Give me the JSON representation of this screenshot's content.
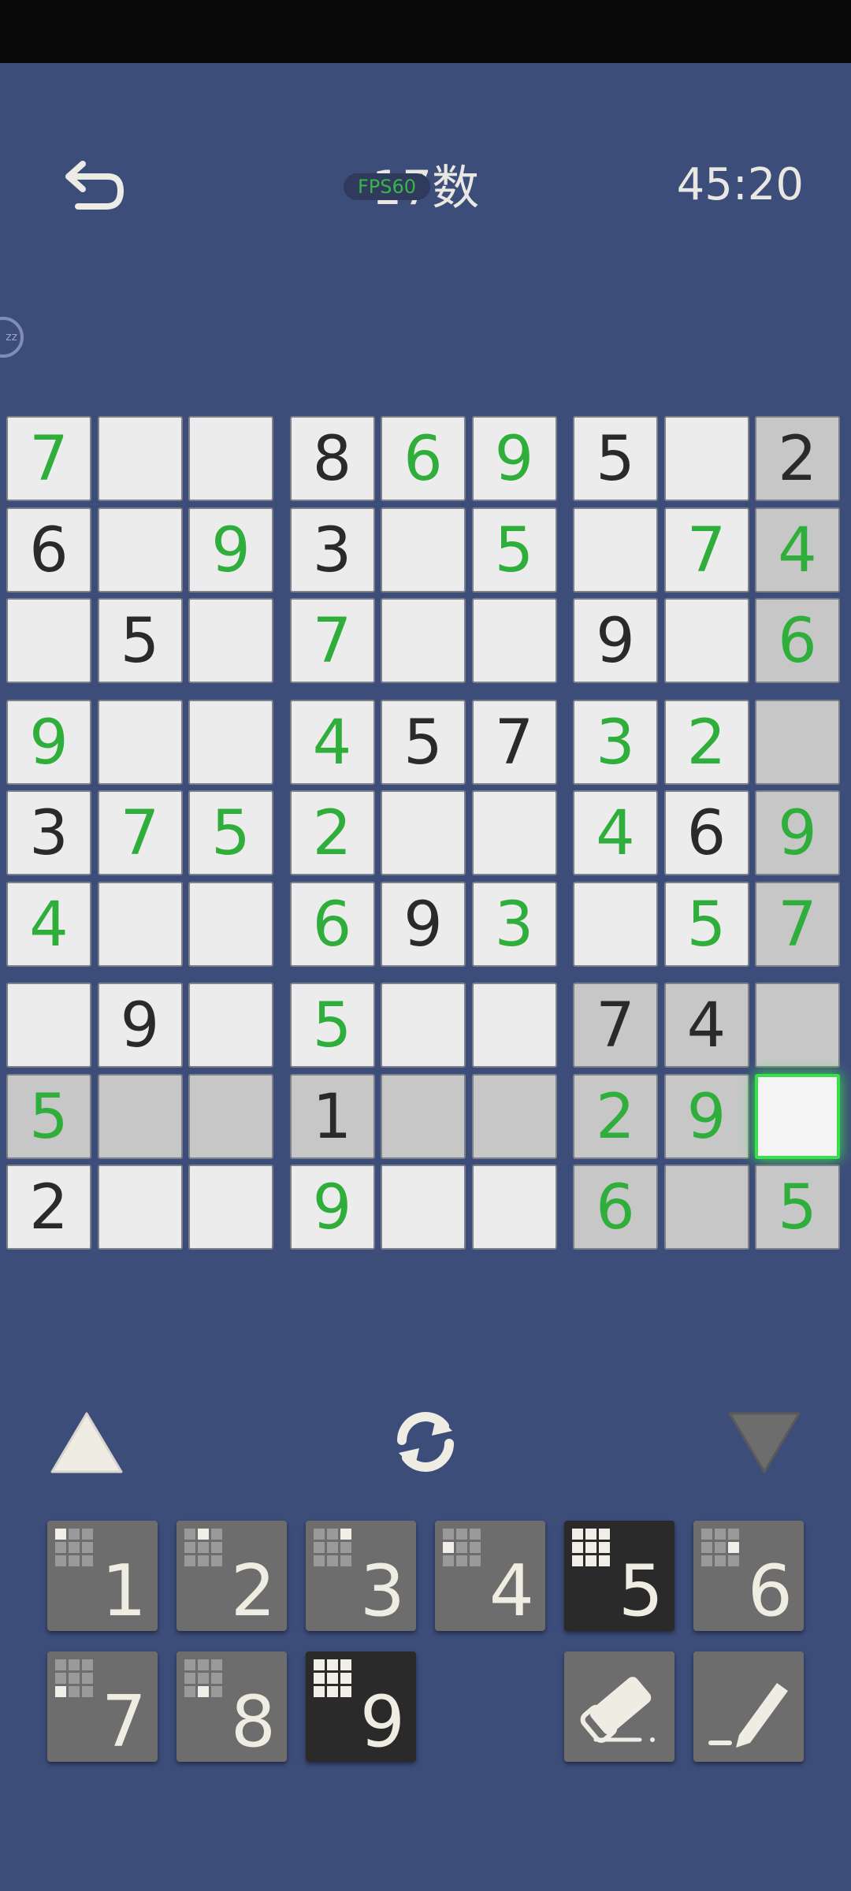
{
  "header": {
    "title": "17数",
    "fps": "FPS60",
    "timer": "45:20"
  },
  "board": {
    "rows": [
      [
        {
          "v": "7",
          "c": "g"
        },
        {
          "v": "",
          "c": ""
        },
        {
          "v": "",
          "c": ""
        },
        {
          "v": "8",
          "c": ""
        },
        {
          "v": "6",
          "c": "g"
        },
        {
          "v": "9",
          "c": "g"
        },
        {
          "v": "5",
          "c": ""
        },
        {
          "v": "",
          "c": ""
        },
        {
          "v": "2",
          "c": "",
          "h": 1
        }
      ],
      [
        {
          "v": "6",
          "c": ""
        },
        {
          "v": "",
          "c": ""
        },
        {
          "v": "9",
          "c": "g"
        },
        {
          "v": "3",
          "c": ""
        },
        {
          "v": "",
          "c": ""
        },
        {
          "v": "5",
          "c": "g"
        },
        {
          "v": "",
          "c": ""
        },
        {
          "v": "7",
          "c": "g"
        },
        {
          "v": "4",
          "c": "g",
          "h": 1
        }
      ],
      [
        {
          "v": "",
          "c": ""
        },
        {
          "v": "5",
          "c": ""
        },
        {
          "v": "",
          "c": ""
        },
        {
          "v": "7",
          "c": "g"
        },
        {
          "v": "",
          "c": ""
        },
        {
          "v": "",
          "c": ""
        },
        {
          "v": "9",
          "c": ""
        },
        {
          "v": "",
          "c": ""
        },
        {
          "v": "6",
          "c": "g",
          "h": 1
        }
      ],
      [
        {
          "v": "9",
          "c": "g"
        },
        {
          "v": "",
          "c": ""
        },
        {
          "v": "",
          "c": ""
        },
        {
          "v": "4",
          "c": "g"
        },
        {
          "v": "5",
          "c": ""
        },
        {
          "v": "7",
          "c": ""
        },
        {
          "v": "3",
          "c": "g"
        },
        {
          "v": "2",
          "c": "g"
        },
        {
          "v": "",
          "c": "",
          "h": 1
        }
      ],
      [
        {
          "v": "3",
          "c": ""
        },
        {
          "v": "7",
          "c": "g"
        },
        {
          "v": "5",
          "c": "g"
        },
        {
          "v": "2",
          "c": "g"
        },
        {
          "v": "",
          "c": ""
        },
        {
          "v": "",
          "c": ""
        },
        {
          "v": "4",
          "c": "g"
        },
        {
          "v": "6",
          "c": ""
        },
        {
          "v": "9",
          "c": "g",
          "h": 1
        }
      ],
      [
        {
          "v": "4",
          "c": "g"
        },
        {
          "v": "",
          "c": ""
        },
        {
          "v": "",
          "c": ""
        },
        {
          "v": "6",
          "c": "g"
        },
        {
          "v": "9",
          "c": ""
        },
        {
          "v": "3",
          "c": "g"
        },
        {
          "v": "",
          "c": ""
        },
        {
          "v": "5",
          "c": "g"
        },
        {
          "v": "7",
          "c": "g",
          "h": 1
        }
      ],
      [
        {
          "v": "",
          "c": ""
        },
        {
          "v": "9",
          "c": ""
        },
        {
          "v": "",
          "c": ""
        },
        {
          "v": "5",
          "c": "g"
        },
        {
          "v": "",
          "c": ""
        },
        {
          "v": "",
          "c": ""
        },
        {
          "v": "7",
          "c": "",
          "h": 1
        },
        {
          "v": "4",
          "c": "",
          "h": 1
        },
        {
          "v": "",
          "c": "",
          "h": 1
        }
      ],
      [
        {
          "v": "5",
          "c": "g",
          "h": 1
        },
        {
          "v": "",
          "c": "",
          "h": 1
        },
        {
          "v": "",
          "c": "",
          "h": 1
        },
        {
          "v": "1",
          "c": "",
          "h": 1
        },
        {
          "v": "",
          "c": "",
          "h": 1
        },
        {
          "v": "",
          "c": "",
          "h": 1
        },
        {
          "v": "2",
          "c": "g",
          "h": 1
        },
        {
          "v": "9",
          "c": "g",
          "h": 1
        },
        {
          "v": "",
          "c": "",
          "s": 1
        }
      ],
      [
        {
          "v": "2",
          "c": ""
        },
        {
          "v": "",
          "c": ""
        },
        {
          "v": "",
          "c": ""
        },
        {
          "v": "9",
          "c": "g"
        },
        {
          "v": "",
          "c": ""
        },
        {
          "v": "",
          "c": ""
        },
        {
          "v": "6",
          "c": "g",
          "h": 1
        },
        {
          "v": "",
          "c": "",
          "h": 1
        },
        {
          "v": "5",
          "c": "g",
          "h": 1
        }
      ]
    ]
  },
  "numbers": [
    {
      "digit": "1",
      "done": false
    },
    {
      "digit": "2",
      "done": false
    },
    {
      "digit": "3",
      "done": false
    },
    {
      "digit": "4",
      "done": false
    },
    {
      "digit": "5",
      "done": true
    },
    {
      "digit": "6",
      "done": false
    },
    {
      "digit": "7",
      "done": false
    },
    {
      "digit": "8",
      "done": false
    },
    {
      "digit": "9",
      "done": true
    }
  ],
  "colors": {
    "background": "#3d4d7a",
    "given": "#2a2a2a",
    "entered": "#2fae3c",
    "highlight": "#c7c7c7",
    "selected_glow": "#39e04a"
  },
  "icons": {
    "back": "undo-arrow-icon",
    "up": "triangle-up-icon",
    "refresh": "refresh-icon",
    "down": "triangle-down-icon",
    "eraser": "eraser-icon",
    "pencil": "pencil-icon"
  }
}
